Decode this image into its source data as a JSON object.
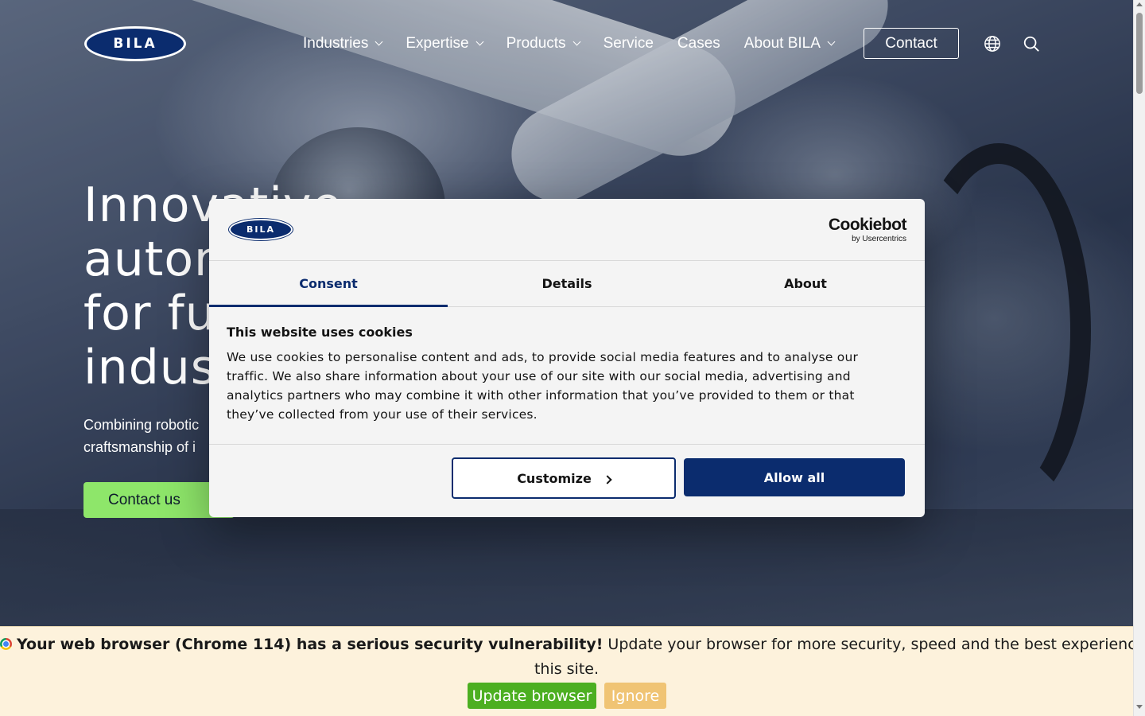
{
  "header": {
    "logo_text": "BILA",
    "nav": [
      {
        "label": "Industries",
        "has_dropdown": true
      },
      {
        "label": "Expertise",
        "has_dropdown": true
      },
      {
        "label": "Products",
        "has_dropdown": true
      },
      {
        "label": "Service",
        "has_dropdown": false
      },
      {
        "label": "Cases",
        "has_dropdown": false
      },
      {
        "label": "About BILA",
        "has_dropdown": true
      }
    ],
    "contact_label": "Contact",
    "icons": [
      "globe-icon",
      "search-icon"
    ]
  },
  "hero": {
    "title_lines": [
      "Innovative",
      "autom",
      "for fu",
      "indus"
    ],
    "subtitle_lines": [
      "Combining robotic",
      "craftsmanship of i"
    ],
    "cta_label": "Contact us"
  },
  "cookie_dialog": {
    "logo_text": "BILA",
    "brand_name": "Cookiebot",
    "brand_by": "by Usercentrics",
    "tabs": [
      {
        "label": "Consent",
        "active": true
      },
      {
        "label": "Details",
        "active": false
      },
      {
        "label": "About",
        "active": false
      }
    ],
    "title": "This website uses cookies",
    "text_lines": [
      "We use cookies to personalise content and ads, to provide social media features and to analyse our",
      "traffic. We also share information about your use of our site with our social media, advertising and",
      "analytics partners who may combine it with other information that you’ve provided to them or that",
      "they’ve collected from your use of their services."
    ],
    "customize_label": "Customize",
    "allow_all_label": "Allow all"
  },
  "update_bar": {
    "bold_text": "Your web browser (Chrome 114) has a serious security vulnerability!",
    "text": "Update your browser for more security, speed and the best experience on",
    "text_line2": "this site.",
    "update_label": "Update browser",
    "ignore_label": "Ignore"
  },
  "colors": {
    "brand_navy": "#0b2c6e",
    "cta_green": "#8ee66a",
    "update_green": "#4caf21",
    "ignore_orange": "#f0c474",
    "update_bar_bg": "#fdf2dc"
  }
}
